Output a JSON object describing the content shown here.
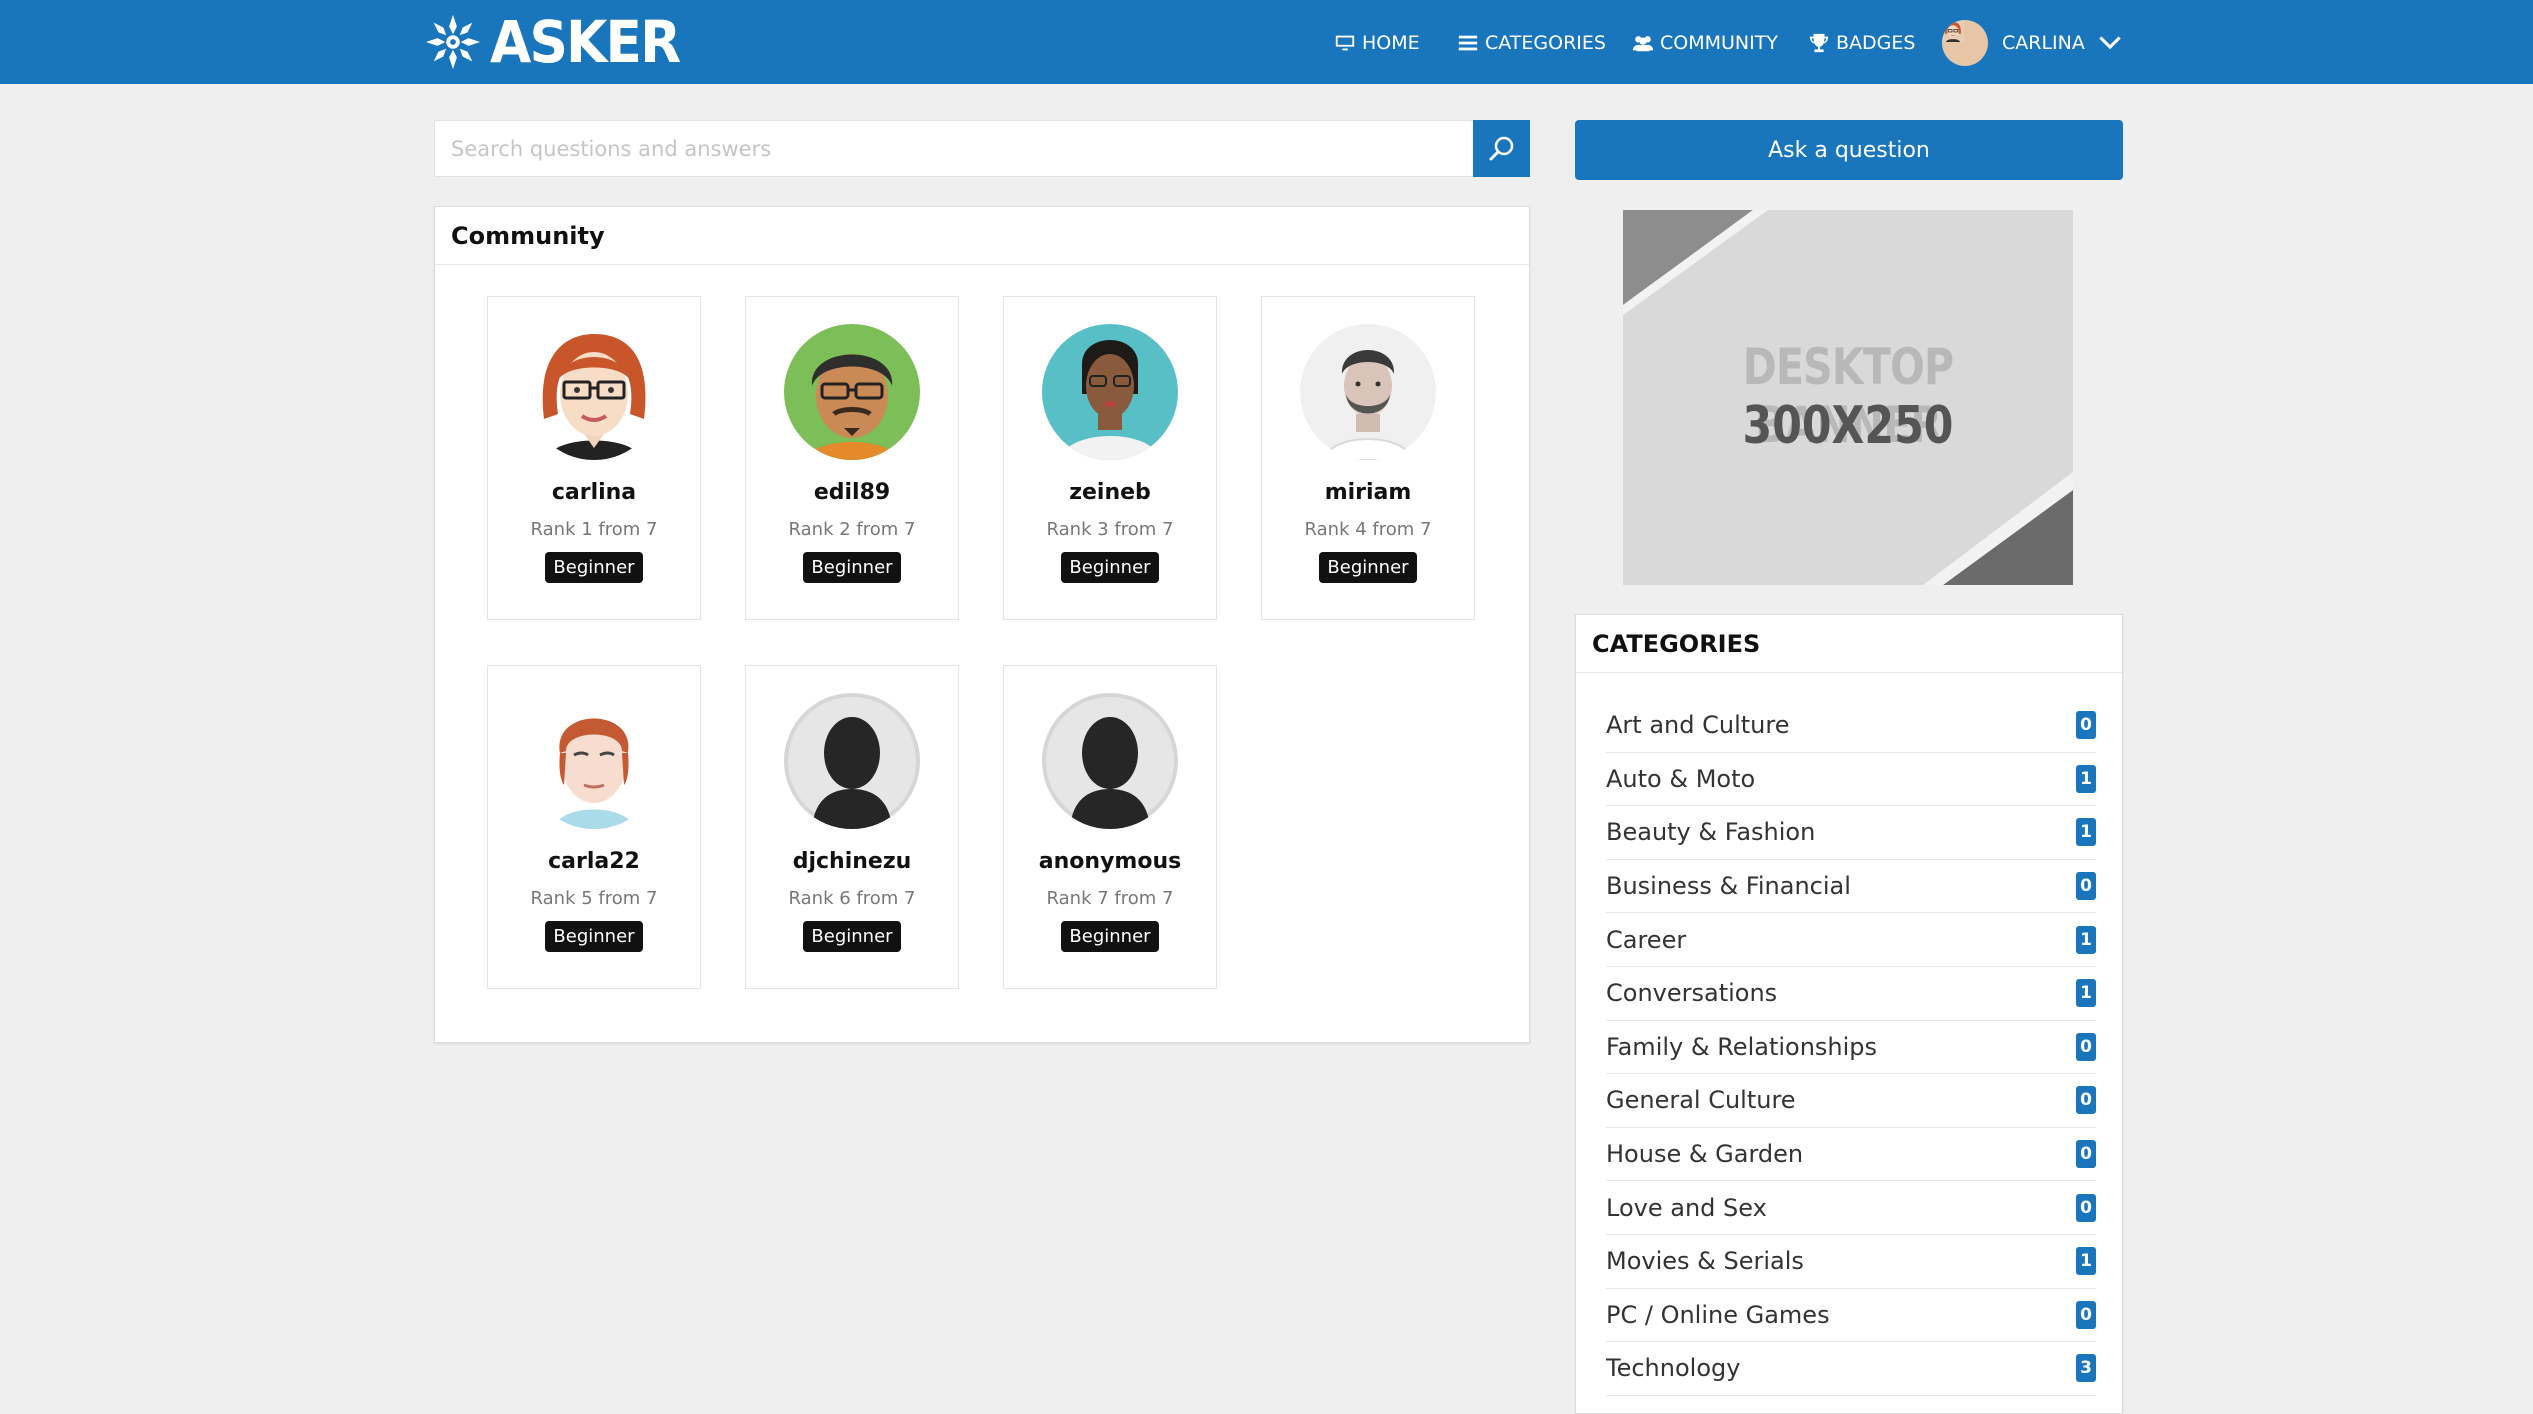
{
  "app": {
    "brand": "ASKER"
  },
  "nav": {
    "home": "HOME",
    "categories": "CATEGORIES",
    "community": "COMMUNITY",
    "badges": "BADGES",
    "user": "CARLINA"
  },
  "search": {
    "placeholder": "Search questions and answers",
    "value": ""
  },
  "ask_button": "Ask a question",
  "community": {
    "title": "Community",
    "users": [
      {
        "name": "carlina",
        "rank": "Rank 1 from 7",
        "badge": "Beginner"
      },
      {
        "name": "edil89",
        "rank": "Rank 2 from 7",
        "badge": "Beginner"
      },
      {
        "name": "zeineb",
        "rank": "Rank 3 from 7",
        "badge": "Beginner"
      },
      {
        "name": "miriam",
        "rank": "Rank 4 from 7",
        "badge": "Beginner"
      },
      {
        "name": "carla22",
        "rank": "Rank 5 from 7",
        "badge": "Beginner"
      },
      {
        "name": "djchinezu",
        "rank": "Rank 6 from 7",
        "badge": "Beginner"
      },
      {
        "name": "anonymous",
        "rank": "Rank 7 from 7",
        "badge": "Beginner"
      }
    ]
  },
  "banner": {
    "line1": "DESKTOP BANNER",
    "line2": "300X250"
  },
  "categories": {
    "title": "CATEGORIES",
    "items": [
      {
        "label": "Art and Culture",
        "count": "0"
      },
      {
        "label": "Auto & Moto",
        "count": "1"
      },
      {
        "label": "Beauty & Fashion",
        "count": "1"
      },
      {
        "label": "Business & Financial",
        "count": "0"
      },
      {
        "label": "Career",
        "count": "1"
      },
      {
        "label": "Conversations",
        "count": "1"
      },
      {
        "label": "Family & Relationships",
        "count": "0"
      },
      {
        "label": "General Culture",
        "count": "0"
      },
      {
        "label": "House & Garden",
        "count": "0"
      },
      {
        "label": "Love and Sex",
        "count": "0"
      },
      {
        "label": "Movies & Serials",
        "count": "1"
      },
      {
        "label": "PC / Online Games",
        "count": "0"
      },
      {
        "label": "Technology",
        "count": "3"
      }
    ]
  },
  "colors": {
    "primary": "#1976bd",
    "badge_bg": "#111111",
    "page_bg": "#efefef"
  }
}
